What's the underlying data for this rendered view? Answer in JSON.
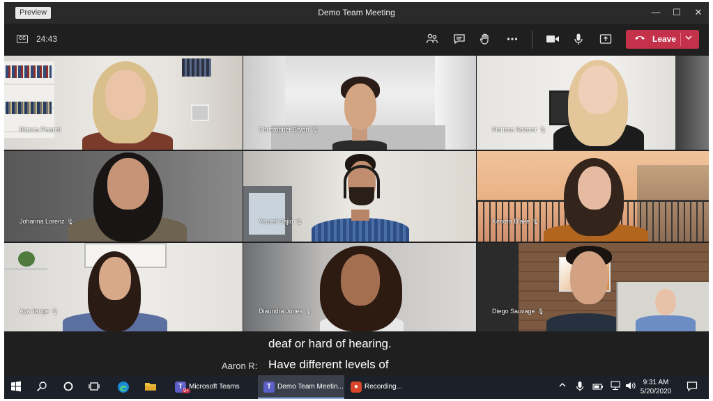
{
  "window": {
    "preview_badge": "Preview",
    "title": "Demo Team Meeting",
    "minimize_glyph": "—",
    "maximize_glyph": "☐",
    "close_glyph": "✕"
  },
  "toolbar": {
    "captions_icon_text": "CC",
    "timer": "24:43",
    "leave_label": "Leave"
  },
  "participants": [
    {
      "name": "Bianca Pisanni",
      "mic": false
    },
    {
      "name": "Christopher Bryan",
      "mic": true
    },
    {
      "name": "Marissa Salazar",
      "mic": true
    },
    {
      "name": "Johanna Lorenz",
      "mic": true
    },
    {
      "name": "Yousef Sajid",
      "mic": true
    },
    {
      "name": "Kendra Blake",
      "mic": true
    },
    {
      "name": "Aya Tange",
      "mic": true
    },
    {
      "name": "Diaundra Jones",
      "mic": true
    },
    {
      "name": "Diego Sauvage",
      "mic": true
    }
  ],
  "captions": {
    "line1": "deaf or hard of hearing.",
    "speaker": "Aaron R:",
    "line2": "Have different levels of"
  },
  "taskbar": {
    "apps": [
      {
        "label": "Microsoft Teams",
        "badge": "9+",
        "active": false
      },
      {
        "label": "Demo Team Meetin...",
        "active": true
      },
      {
        "label": "Recording...",
        "active": false
      }
    ],
    "time": "9:31 AM",
    "date": "5/20/2020"
  },
  "colors": {
    "leave_button": "#c4314b",
    "teams_purple": "#5b5fc7",
    "recording_red": "#d9472b",
    "taskbar_bg": "#1c2129"
  }
}
